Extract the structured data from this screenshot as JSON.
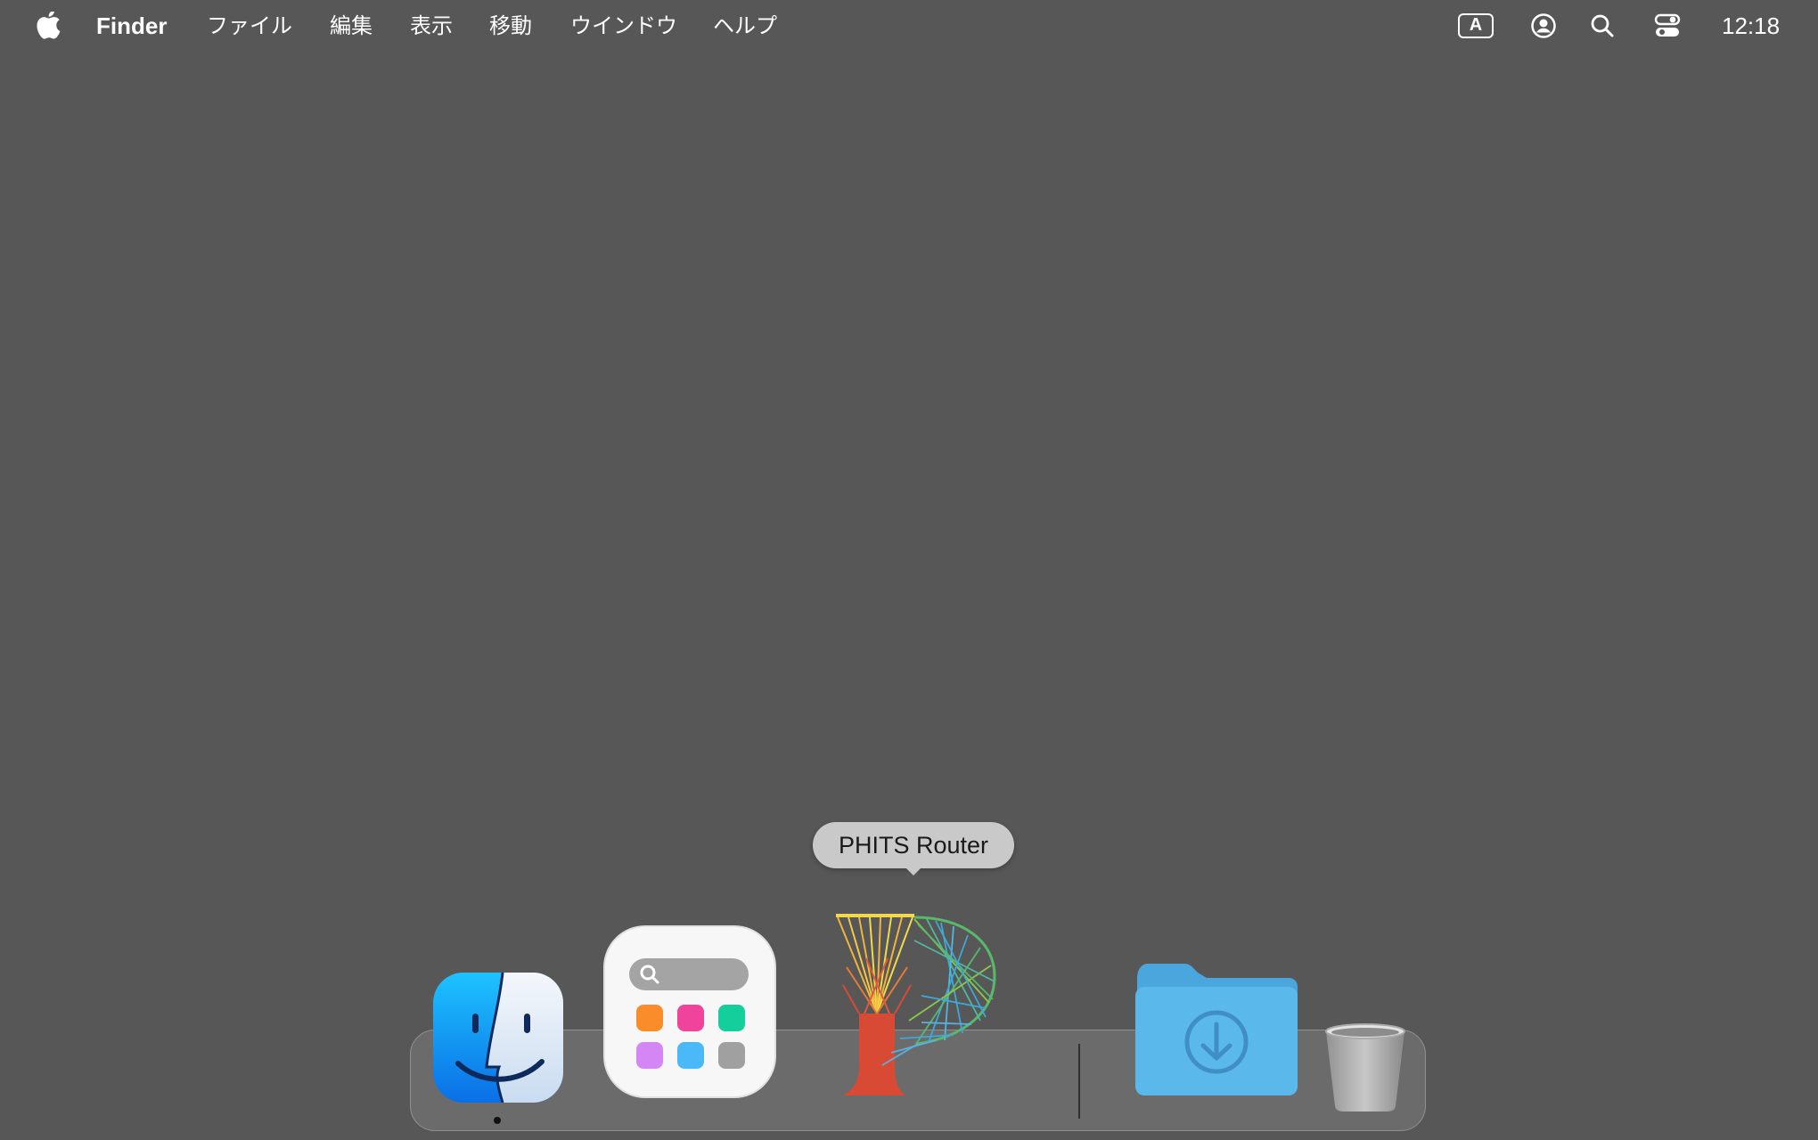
{
  "menubar": {
    "apple_icon": "apple-logo-icon",
    "app_name": "Finder",
    "menus": [
      "ファイル",
      "編集",
      "表示",
      "移動",
      "ウインドウ",
      "ヘルプ"
    ],
    "status": {
      "input_method": "A",
      "user_icon": "user-circle-icon",
      "search_icon": "search-icon",
      "control_center_icon": "control-center-icon",
      "clock": "12:18"
    }
  },
  "dock": {
    "tooltip": "PHITS Router",
    "items": [
      {
        "name": "Finder",
        "icon": "finder-icon",
        "running": true
      },
      {
        "name": "Launchpad",
        "icon": "launchpad-icon",
        "running": false
      },
      {
        "name": "PHITS Router",
        "icon": "phits-router-icon",
        "running": false
      },
      {
        "name": "Downloads",
        "icon": "downloads-folder-icon",
        "running": false
      },
      {
        "name": "Trash",
        "icon": "trash-icon",
        "running": false
      }
    ]
  },
  "colors": {
    "desktop": "#575757",
    "finder_blue": "#1e9bf0",
    "folder_blue": "#5bb8ea",
    "phits_red": "#d94a35"
  }
}
